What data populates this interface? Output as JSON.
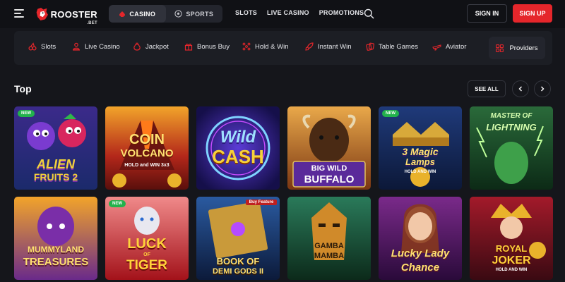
{
  "brand": {
    "name": "ROOSTER",
    "sub": ".BET"
  },
  "toggle": {
    "casino": "CASINO",
    "sports": "SPORTS"
  },
  "topnav": [
    "SLOTS",
    "LIVE CASINO",
    "PROMOTIONS"
  ],
  "auth": {
    "signin": "SIGN IN",
    "signup": "SIGN UP"
  },
  "categories": [
    {
      "label": "Slots",
      "icon": "cherries-icon"
    },
    {
      "label": "Live Casino",
      "icon": "dealer-icon"
    },
    {
      "label": "Jackpot",
      "icon": "money-bag-icon"
    },
    {
      "label": "Bonus Buy",
      "icon": "gift-icon"
    },
    {
      "label": "Hold & Win",
      "icon": "grid-dots-icon"
    },
    {
      "label": "Instant Win",
      "icon": "rocket-icon"
    },
    {
      "label": "Table Games",
      "icon": "cards-icon"
    },
    {
      "label": "Aviator",
      "icon": "plane-icon"
    }
  ],
  "providers_label": "Providers",
  "section": {
    "title": "Top",
    "see_all": "SEE ALL"
  },
  "games": [
    {
      "badge": "NEW",
      "line1": "ALIEN",
      "line2": "FRUITS 2"
    },
    {
      "badge": "",
      "line1": "COIN",
      "line2": "VOLCANO",
      "line3": "HOLD and WIN 3x3"
    },
    {
      "badge": "",
      "line1": "Wild",
      "line2": "CASH"
    },
    {
      "badge": "",
      "line1": "BIG WILD",
      "line2": "BUFFALO"
    },
    {
      "badge": "NEW",
      "line1": "3 Magic",
      "line2": "Lamps",
      "line3": "HOLD AND WIN"
    },
    {
      "badge": "",
      "line1": "MASTER OF",
      "line2": "LIGHTNING"
    },
    {
      "badge": "",
      "line1": "MUMMYLAND",
      "line2": "TREASURES"
    },
    {
      "badge": "NEW",
      "line1": "LUCK",
      "line2": "TIGER",
      "line3": "OF"
    },
    {
      "badge": "",
      "line1": "BOOK OF",
      "line2": "DEMI GODS II",
      "line3": "Buy Feature"
    },
    {
      "badge": "",
      "line1": "GAMBA",
      "line2": "MAMBA"
    },
    {
      "badge": "",
      "line1": "Lucky Lady",
      "line2": "Chance"
    },
    {
      "badge": "",
      "line1": "ROYAL",
      "line2": "JOKER",
      "line3": "HOLD AND WIN"
    }
  ],
  "colors": {
    "accent": "#e5262b",
    "background": "#15161b",
    "new_badge": "#22b24c"
  }
}
